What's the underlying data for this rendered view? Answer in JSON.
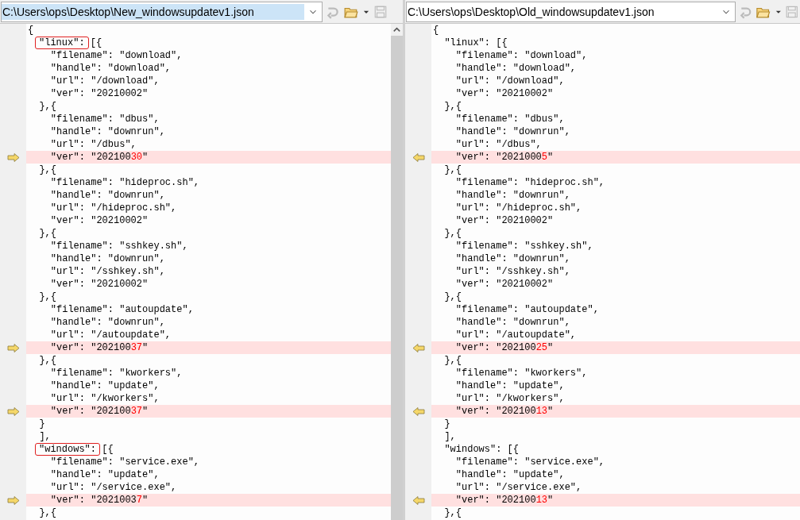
{
  "panes": [
    {
      "path": "C:\\Users\\ops\\Desktop\\New_windowsupdatev1.json",
      "selected": true,
      "lines": [
        {
          "diff": false,
          "parts": [
            {
              "text": "{",
              "kind": "plain"
            }
          ]
        },
        {
          "diff": false,
          "parts": [
            {
              "text": "\"linux\":",
              "kind": "boxed"
            },
            {
              "text": " [{",
              "kind": "plain"
            }
          ]
        },
        {
          "diff": false,
          "parts": [
            {
              "text": "    \"filename\": \"download\",",
              "kind": "plain"
            }
          ]
        },
        {
          "diff": false,
          "parts": [
            {
              "text": "    \"handle\": \"download\",",
              "kind": "plain"
            }
          ]
        },
        {
          "diff": false,
          "parts": [
            {
              "text": "    \"url\": \"/download\",",
              "kind": "plain"
            }
          ]
        },
        {
          "diff": false,
          "parts": [
            {
              "text": "    \"ver\": \"20210002\"",
              "kind": "plain"
            }
          ]
        },
        {
          "diff": false,
          "parts": [
            {
              "text": "  },{",
              "kind": "plain"
            }
          ]
        },
        {
          "diff": false,
          "parts": [
            {
              "text": "    \"filename\": \"dbus\",",
              "kind": "plain"
            }
          ]
        },
        {
          "diff": false,
          "parts": [
            {
              "text": "    \"handle\": \"downrun\",",
              "kind": "plain"
            }
          ]
        },
        {
          "diff": false,
          "parts": [
            {
              "text": "    \"url\": \"/dbus\",",
              "kind": "plain"
            }
          ]
        },
        {
          "diff": true,
          "parts": [
            {
              "text": "    \"ver\": \"202100",
              "kind": "plain"
            },
            {
              "text": "30",
              "kind": "changed"
            },
            {
              "text": "\"",
              "kind": "plain"
            }
          ]
        },
        {
          "diff": false,
          "parts": [
            {
              "text": "  },{",
              "kind": "plain"
            }
          ]
        },
        {
          "diff": false,
          "parts": [
            {
              "text": "    \"filename\": \"hideproc.sh\",",
              "kind": "plain"
            }
          ]
        },
        {
          "diff": false,
          "parts": [
            {
              "text": "    \"handle\": \"downrun\",",
              "kind": "plain"
            }
          ]
        },
        {
          "diff": false,
          "parts": [
            {
              "text": "    \"url\": \"/hideproc.sh\",",
              "kind": "plain"
            }
          ]
        },
        {
          "diff": false,
          "parts": [
            {
              "text": "    \"ver\": \"20210002\"",
              "kind": "plain"
            }
          ]
        },
        {
          "diff": false,
          "parts": [
            {
              "text": "  },{",
              "kind": "plain"
            }
          ]
        },
        {
          "diff": false,
          "parts": [
            {
              "text": "    \"filename\": \"sshkey.sh\",",
              "kind": "plain"
            }
          ]
        },
        {
          "diff": false,
          "parts": [
            {
              "text": "    \"handle\": \"downrun\",",
              "kind": "plain"
            }
          ]
        },
        {
          "diff": false,
          "parts": [
            {
              "text": "    \"url\": \"/sshkey.sh\",",
              "kind": "plain"
            }
          ]
        },
        {
          "diff": false,
          "parts": [
            {
              "text": "    \"ver\": \"20210002\"",
              "kind": "plain"
            }
          ]
        },
        {
          "diff": false,
          "parts": [
            {
              "text": "  },{",
              "kind": "plain"
            }
          ]
        },
        {
          "diff": false,
          "parts": [
            {
              "text": "    \"filename\": \"autoupdate\",",
              "kind": "plain"
            }
          ]
        },
        {
          "diff": false,
          "parts": [
            {
              "text": "    \"handle\": \"downrun\",",
              "kind": "plain"
            }
          ]
        },
        {
          "diff": false,
          "parts": [
            {
              "text": "    \"url\": \"/autoupdate\",",
              "kind": "plain"
            }
          ]
        },
        {
          "diff": true,
          "parts": [
            {
              "text": "    \"ver\": \"202100",
              "kind": "plain"
            },
            {
              "text": "37",
              "kind": "changed"
            },
            {
              "text": "\"",
              "kind": "plain"
            }
          ]
        },
        {
          "diff": false,
          "parts": [
            {
              "text": "  },{",
              "kind": "plain"
            }
          ]
        },
        {
          "diff": false,
          "parts": [
            {
              "text": "    \"filename\": \"kworkers\",",
              "kind": "plain"
            }
          ]
        },
        {
          "diff": false,
          "parts": [
            {
              "text": "    \"handle\": \"update\",",
              "kind": "plain"
            }
          ]
        },
        {
          "diff": false,
          "parts": [
            {
              "text": "    \"url\": \"/kworkers\",",
              "kind": "plain"
            }
          ]
        },
        {
          "diff": true,
          "parts": [
            {
              "text": "    \"ver\": \"202100",
              "kind": "plain"
            },
            {
              "text": "37",
              "kind": "changed"
            },
            {
              "text": "\"",
              "kind": "plain"
            }
          ]
        },
        {
          "diff": false,
          "parts": [
            {
              "text": "  }",
              "kind": "plain"
            }
          ]
        },
        {
          "diff": false,
          "parts": [
            {
              "text": "  ],",
              "kind": "plain"
            }
          ]
        },
        {
          "diff": false,
          "parts": [
            {
              "text": "\"windows\":",
              "kind": "boxed"
            },
            {
              "text": " [{",
              "kind": "plain"
            }
          ]
        },
        {
          "diff": false,
          "parts": [
            {
              "text": "    \"filename\": \"service.exe\",",
              "kind": "plain"
            }
          ]
        },
        {
          "diff": false,
          "parts": [
            {
              "text": "    \"handle\": \"update\",",
              "kind": "plain"
            }
          ]
        },
        {
          "diff": false,
          "parts": [
            {
              "text": "    \"url\": \"/service.exe\",",
              "kind": "plain"
            }
          ]
        },
        {
          "diff": true,
          "parts": [
            {
              "text": "    \"ver\": \"2021003",
              "kind": "plain"
            },
            {
              "text": "7",
              "kind": "changed"
            },
            {
              "text": "\"",
              "kind": "plain"
            }
          ]
        },
        {
          "diff": false,
          "parts": [
            {
              "text": "  },{",
              "kind": "plain"
            }
          ]
        }
      ]
    },
    {
      "path": "C:\\Users\\ops\\Desktop\\Old_windowsupdatev1.json",
      "selected": false,
      "lines": [
        {
          "diff": false,
          "parts": [
            {
              "text": "{",
              "kind": "plain"
            }
          ]
        },
        {
          "diff": false,
          "parts": [
            {
              "text": "  \"linux\": [{",
              "kind": "plain"
            }
          ]
        },
        {
          "diff": false,
          "parts": [
            {
              "text": "    \"filename\": \"download\",",
              "kind": "plain"
            }
          ]
        },
        {
          "diff": false,
          "parts": [
            {
              "text": "    \"handle\": \"download\",",
              "kind": "plain"
            }
          ]
        },
        {
          "diff": false,
          "parts": [
            {
              "text": "    \"url\": \"/download\",",
              "kind": "plain"
            }
          ]
        },
        {
          "diff": false,
          "parts": [
            {
              "text": "    \"ver\": \"20210002\"",
              "kind": "plain"
            }
          ]
        },
        {
          "diff": false,
          "parts": [
            {
              "text": "  },{",
              "kind": "plain"
            }
          ]
        },
        {
          "diff": false,
          "parts": [
            {
              "text": "    \"filename\": \"dbus\",",
              "kind": "plain"
            }
          ]
        },
        {
          "diff": false,
          "parts": [
            {
              "text": "    \"handle\": \"downrun\",",
              "kind": "plain"
            }
          ]
        },
        {
          "diff": false,
          "parts": [
            {
              "text": "    \"url\": \"/dbus\",",
              "kind": "plain"
            }
          ]
        },
        {
          "diff": true,
          "parts": [
            {
              "text": "    \"ver\": \"2021000",
              "kind": "plain"
            },
            {
              "text": "5",
              "kind": "changed"
            },
            {
              "text": "\"",
              "kind": "plain"
            }
          ]
        },
        {
          "diff": false,
          "parts": [
            {
              "text": "  },{",
              "kind": "plain"
            }
          ]
        },
        {
          "diff": false,
          "parts": [
            {
              "text": "    \"filename\": \"hideproc.sh\",",
              "kind": "plain"
            }
          ]
        },
        {
          "diff": false,
          "parts": [
            {
              "text": "    \"handle\": \"downrun\",",
              "kind": "plain"
            }
          ]
        },
        {
          "diff": false,
          "parts": [
            {
              "text": "    \"url\": \"/hideproc.sh\",",
              "kind": "plain"
            }
          ]
        },
        {
          "diff": false,
          "parts": [
            {
              "text": "    \"ver\": \"20210002\"",
              "kind": "plain"
            }
          ]
        },
        {
          "diff": false,
          "parts": [
            {
              "text": "  },{",
              "kind": "plain"
            }
          ]
        },
        {
          "diff": false,
          "parts": [
            {
              "text": "    \"filename\": \"sshkey.sh\",",
              "kind": "plain"
            }
          ]
        },
        {
          "diff": false,
          "parts": [
            {
              "text": "    \"handle\": \"downrun\",",
              "kind": "plain"
            }
          ]
        },
        {
          "diff": false,
          "parts": [
            {
              "text": "    \"url\": \"/sshkey.sh\",",
              "kind": "plain"
            }
          ]
        },
        {
          "diff": false,
          "parts": [
            {
              "text": "    \"ver\": \"20210002\"",
              "kind": "plain"
            }
          ]
        },
        {
          "diff": false,
          "parts": [
            {
              "text": "  },{",
              "kind": "plain"
            }
          ]
        },
        {
          "diff": false,
          "parts": [
            {
              "text": "    \"filename\": \"autoupdate\",",
              "kind": "plain"
            }
          ]
        },
        {
          "diff": false,
          "parts": [
            {
              "text": "    \"handle\": \"downrun\",",
              "kind": "plain"
            }
          ]
        },
        {
          "diff": false,
          "parts": [
            {
              "text": "    \"url\": \"/autoupdate\",",
              "kind": "plain"
            }
          ]
        },
        {
          "diff": true,
          "parts": [
            {
              "text": "    \"ver\": \"202100",
              "kind": "plain"
            },
            {
              "text": "25",
              "kind": "changed"
            },
            {
              "text": "\"",
              "kind": "plain"
            }
          ]
        },
        {
          "diff": false,
          "parts": [
            {
              "text": "  },{",
              "kind": "plain"
            }
          ]
        },
        {
          "diff": false,
          "parts": [
            {
              "text": "    \"filename\": \"kworkers\",",
              "kind": "plain"
            }
          ]
        },
        {
          "diff": false,
          "parts": [
            {
              "text": "    \"handle\": \"update\",",
              "kind": "plain"
            }
          ]
        },
        {
          "diff": false,
          "parts": [
            {
              "text": "    \"url\": \"/kworkers\",",
              "kind": "plain"
            }
          ]
        },
        {
          "diff": true,
          "parts": [
            {
              "text": "    \"ver\": \"202100",
              "kind": "plain"
            },
            {
              "text": "13",
              "kind": "changed"
            },
            {
              "text": "\"",
              "kind": "plain"
            }
          ]
        },
        {
          "diff": false,
          "parts": [
            {
              "text": "  }",
              "kind": "plain"
            }
          ]
        },
        {
          "diff": false,
          "parts": [
            {
              "text": "  ],",
              "kind": "plain"
            }
          ]
        },
        {
          "diff": false,
          "parts": [
            {
              "text": "  \"windows\": [{",
              "kind": "plain"
            }
          ]
        },
        {
          "diff": false,
          "parts": [
            {
              "text": "    \"filename\": \"service.exe\",",
              "kind": "plain"
            }
          ]
        },
        {
          "diff": false,
          "parts": [
            {
              "text": "    \"handle\": \"update\",",
              "kind": "plain"
            }
          ]
        },
        {
          "diff": false,
          "parts": [
            {
              "text": "    \"url\": \"/service.exe\",",
              "kind": "plain"
            }
          ]
        },
        {
          "diff": true,
          "parts": [
            {
              "text": "    \"ver\": \"202100",
              "kind": "plain"
            },
            {
              "text": "13",
              "kind": "changed"
            },
            {
              "text": "\"",
              "kind": "plain"
            }
          ]
        },
        {
          "diff": false,
          "parts": [
            {
              "text": "  },{",
              "kind": "plain"
            }
          ]
        }
      ]
    }
  ]
}
